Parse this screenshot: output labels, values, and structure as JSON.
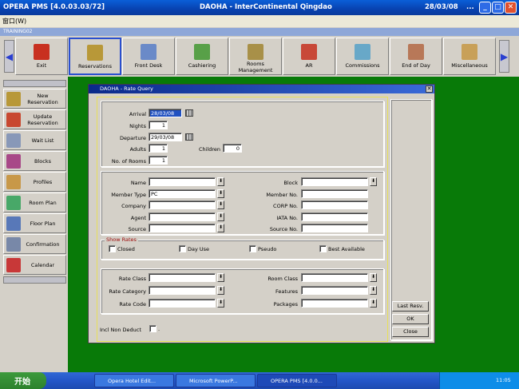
{
  "window": {
    "title": "OPERA PMS [4.0.03.03/72]",
    "center": "DAOHA - InterContinental Qingdao",
    "date": "28/03/08",
    "dots": "...",
    "min": "_",
    "max": "□",
    "close": "✕"
  },
  "menubar": {
    "text": "窗口(W)"
  },
  "subbar": {
    "text": "TRAINING02"
  },
  "toolbar": {
    "left_arrow": "◀",
    "right_arrow": "▶",
    "items": [
      {
        "label": "Exit",
        "icon": "exit-icon"
      },
      {
        "label": "Reservations",
        "icon": "reservations-icon"
      },
      {
        "label": "Front Desk",
        "icon": "front-desk-icon"
      },
      {
        "label": "Cashiering",
        "icon": "cashiering-icon"
      },
      {
        "label": "Rooms Management",
        "icon": "rooms-management-icon"
      },
      {
        "label": "AR",
        "icon": "ar-icon"
      },
      {
        "label": "Commissions",
        "icon": "commissions-icon"
      },
      {
        "label": "End of Day",
        "icon": "end-of-day-icon"
      },
      {
        "label": "Miscellaneous",
        "icon": "miscellaneous-icon"
      }
    ]
  },
  "sidebar": {
    "items": [
      {
        "label": "New Reservation",
        "icon": "new-reservation-icon"
      },
      {
        "label": "Update Reservation",
        "icon": "update-reservation-icon"
      },
      {
        "label": "Wait List",
        "icon": "wait-list-icon"
      },
      {
        "label": "Blocks",
        "icon": "blocks-icon"
      },
      {
        "label": "Profiles",
        "icon": "profiles-icon"
      },
      {
        "label": "Room Plan",
        "icon": "room-plan-icon"
      },
      {
        "label": "Floor Plan",
        "icon": "floor-plan-icon"
      },
      {
        "label": "Confirmation",
        "icon": "confirmation-icon"
      },
      {
        "label": "Calendar",
        "icon": "calendar-icon"
      }
    ]
  },
  "dialog": {
    "title": "DAOHA - Rate Query",
    "close": "✕",
    "arrival": {
      "label": "Arrival",
      "value": "28/03/08"
    },
    "nights": {
      "label": "Nights",
      "value": "1"
    },
    "departure": {
      "label": "Departure",
      "value": "29/03/08"
    },
    "adults": {
      "label": "Adults",
      "value": "1"
    },
    "children": {
      "label": "Children",
      "value": "0"
    },
    "rooms": {
      "label": "No. of Rooms",
      "value": "1"
    },
    "name": {
      "label": "Name",
      "value": ""
    },
    "member_type": {
      "label": "Member Type",
      "value": "PC"
    },
    "company": {
      "label": "Company",
      "value": ""
    },
    "agent": {
      "label": "Agent",
      "value": ""
    },
    "source": {
      "label": "Source",
      "value": ""
    },
    "block": {
      "label": "Block",
      "value": ""
    },
    "member_no": {
      "label": "Member No.",
      "value": ""
    },
    "corp_no": {
      "label": "CORP No.",
      "value": ""
    },
    "iata_no": {
      "label": "IATA No.",
      "value": ""
    },
    "source_no": {
      "label": "Source No.",
      "value": ""
    },
    "show_rates": {
      "label": "Show Rates",
      "closed": "Closed",
      "day_use": "Day Use",
      "pseudo": "Pseudo",
      "best_available": "Best Available"
    },
    "rate_class": {
      "label": "Rate Class",
      "value": ""
    },
    "rate_category": {
      "label": "Rate Category",
      "value": ""
    },
    "rate_code": {
      "label": "Rate Code",
      "value": ""
    },
    "room_class": {
      "label": "Room Class",
      "value": ""
    },
    "features": {
      "label": "Features",
      "value": ""
    },
    "packages": {
      "label": "Packages",
      "value": ""
    },
    "incl_non_deduct": {
      "label": "Incl Non Deduct",
      "suffix": "."
    },
    "buttons": {
      "last_resv": "Last Resv.",
      "ok": "OK",
      "close": "Close"
    },
    "dropdown_glyph": "⬇"
  },
  "taskbar": {
    "start": "开始",
    "items": [
      {
        "label": "Opera Hotel Edit..."
      },
      {
        "label": "Microsoft PowerP..."
      },
      {
        "label": "OPERA PMS [4.0.0..."
      }
    ],
    "time": "11:05"
  }
}
